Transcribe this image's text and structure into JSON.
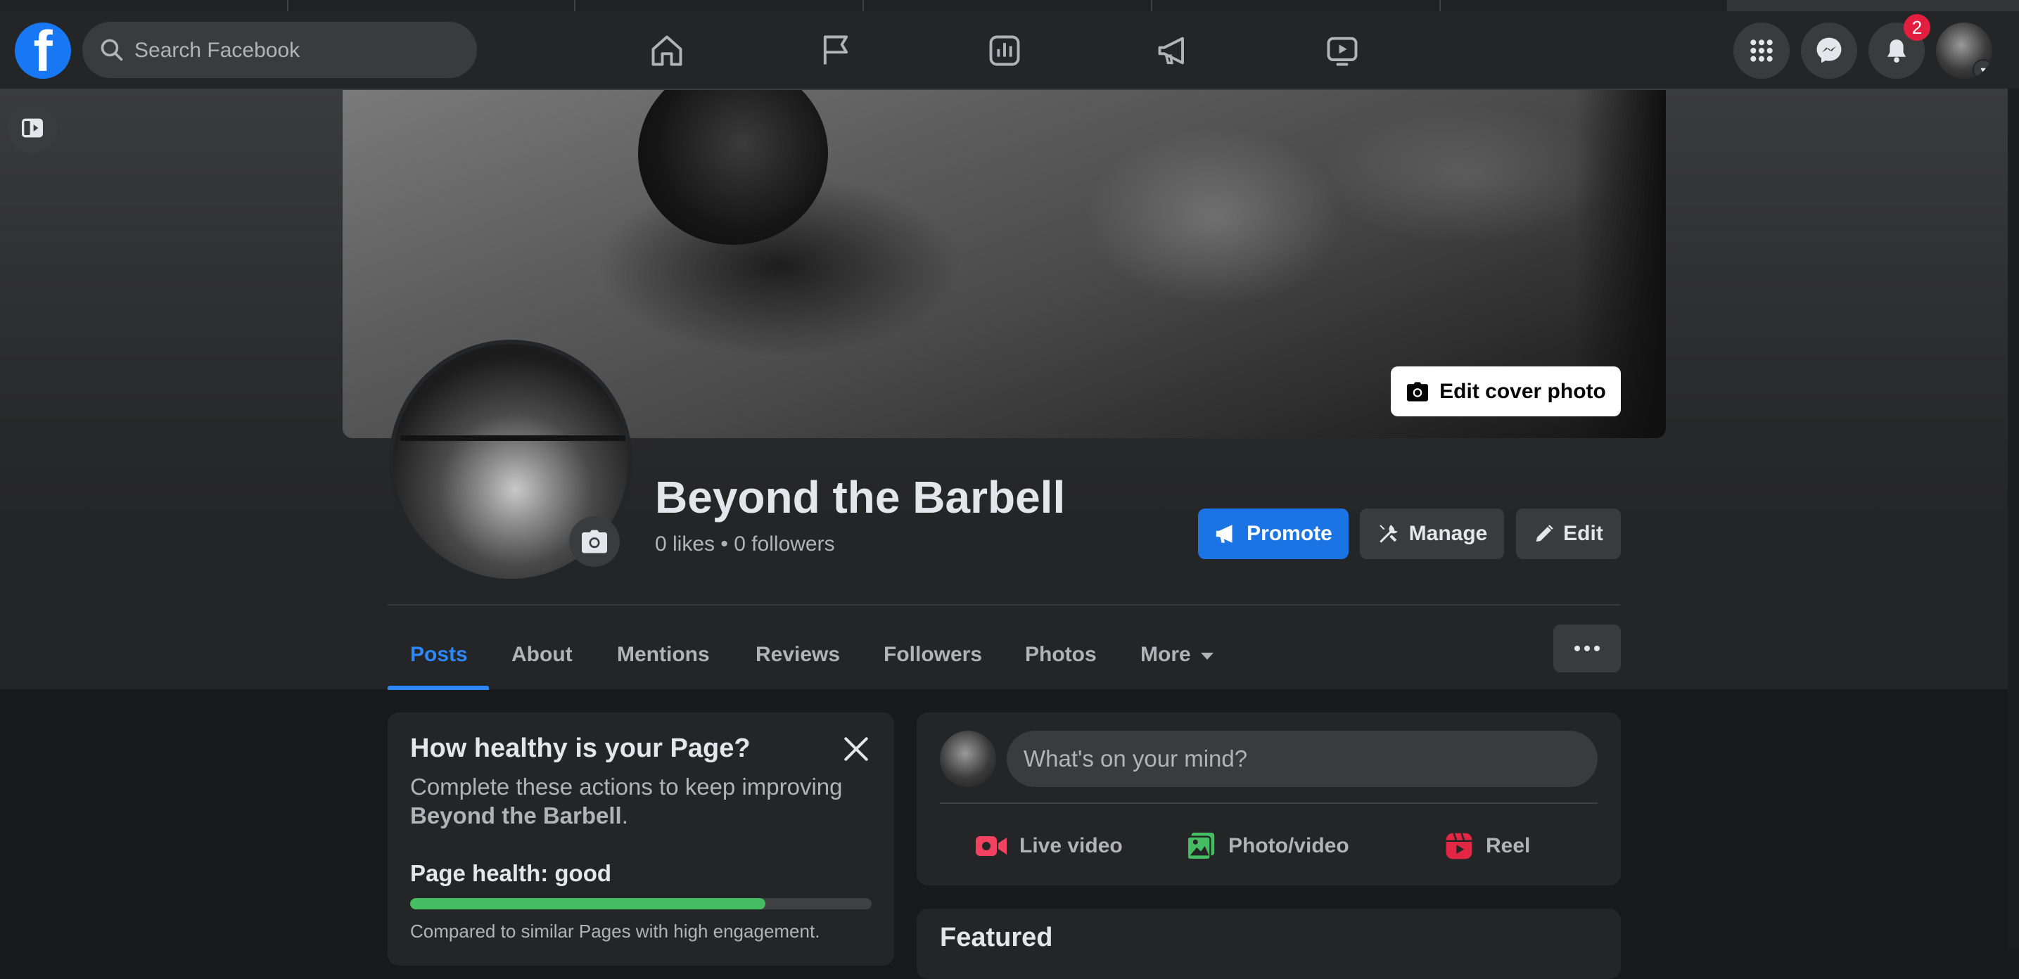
{
  "search": {
    "placeholder": "Search Facebook"
  },
  "notifications": {
    "count": "2"
  },
  "page": {
    "name": "Beyond the Barbell",
    "stats": "0 likes • 0 followers"
  },
  "header_buttons": {
    "edit_cover": "Edit cover photo",
    "promote": "Promote",
    "manage": "Manage",
    "edit": "Edit"
  },
  "tabs": [
    {
      "label": "Posts"
    },
    {
      "label": "About"
    },
    {
      "label": "Mentions"
    },
    {
      "label": "Reviews"
    },
    {
      "label": "Followers"
    },
    {
      "label": "Photos"
    },
    {
      "label": "More"
    }
  ],
  "health": {
    "title": "How healthy is your Page?",
    "desc_prefix": "Complete these actions to keep improving ",
    "desc_page": "Beyond the Barbell",
    "desc_suffix": ".",
    "status": "Page health: good",
    "progress": 0.77,
    "note": "Compared to similar Pages with high engagement."
  },
  "composer": {
    "placeholder": "What's on your mind?",
    "actions": [
      {
        "label": "Live video",
        "icon": "live-video-icon",
        "color": "#f3425f"
      },
      {
        "label": "Photo/video",
        "icon": "photo-video-icon",
        "color": "#45bd62"
      },
      {
        "label": "Reel",
        "icon": "reel-icon",
        "color": "#e42645"
      }
    ]
  },
  "featured": {
    "title": "Featured"
  },
  "colors": {
    "accent": "#1b74e4",
    "tab_active": "#2d88ff",
    "background": "#18191a",
    "surface": "#242526",
    "health_good": "#45bd62",
    "badge": "#e41e3f"
  }
}
